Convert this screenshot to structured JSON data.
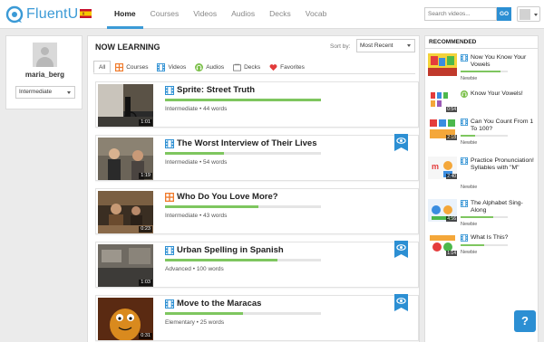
{
  "header": {
    "brand": "FluentU",
    "nav": [
      {
        "label": "Home",
        "active": true
      },
      {
        "label": "Courses",
        "active": false
      },
      {
        "label": "Videos",
        "active": false
      },
      {
        "label": "Audios",
        "active": false
      },
      {
        "label": "Decks",
        "active": false
      },
      {
        "label": "Vocab",
        "active": false
      }
    ],
    "search_placeholder": "Search videos...",
    "go_label": "GO"
  },
  "profile": {
    "username": "maria_berg",
    "level": "Intermediate"
  },
  "main": {
    "title": "NOW LEARNING",
    "sort_label": "Sort by:",
    "sort_value": "Most Recent",
    "filters": [
      {
        "label": "All",
        "icon": "none",
        "active": true
      },
      {
        "label": "Courses",
        "icon": "course-icon",
        "active": false
      },
      {
        "label": "Videos",
        "icon": "video-icon",
        "active": false
      },
      {
        "label": "Audios",
        "icon": "audio-icon",
        "active": false
      },
      {
        "label": "Decks",
        "icon": "deck-icon",
        "active": false
      },
      {
        "label": "Favorites",
        "icon": "heart-icon",
        "active": false
      }
    ],
    "cards": [
      {
        "title": "Sprite: Street Truth",
        "type": "video",
        "level": "Intermediate",
        "words": "44 words",
        "duration": "1:01",
        "progress": 1.0,
        "bookmarked": false
      },
      {
        "title": "The Worst Interview of Their Lives",
        "type": "video",
        "level": "Intermediate",
        "words": "54 words",
        "duration": "1:19",
        "progress": 0.38,
        "bookmarked": true
      },
      {
        "title": "Who Do You Love More?",
        "type": "course",
        "level": "Intermediate",
        "words": "43 words",
        "duration": "0:23",
        "progress": 0.6,
        "bookmarked": false
      },
      {
        "title": "Urban Spelling in Spanish",
        "type": "video",
        "level": "Advanced",
        "words": "100 words",
        "duration": "1:03",
        "progress": 0.72,
        "bookmarked": true
      },
      {
        "title": "Move to the Maracas",
        "type": "video",
        "level": "Elementary",
        "words": "25 words",
        "duration": "0:31",
        "progress": 0.5,
        "bookmarked": true
      }
    ]
  },
  "recommended": {
    "title": "RECOMMENDED",
    "items": [
      {
        "title": "Now You Know Your Vowels",
        "type": "video",
        "level": "Newbie",
        "duration": "",
        "progress": 0.85
      },
      {
        "title": "Know Your Vowels!",
        "type": "audio",
        "level": "",
        "duration": "0:54",
        "progress": 0
      },
      {
        "title": "Can You Count From 1 To 100?",
        "type": "video",
        "level": "Newbie",
        "duration": "2:18",
        "progress": 0.3
      },
      {
        "title": "Practice Pronunciation! Syllables with \"M\"",
        "type": "video",
        "level": "Newbie",
        "duration": "2:40",
        "progress": 0
      },
      {
        "title": "The Alphabet Sing-Along",
        "type": "video",
        "level": "Newbie",
        "duration": "4:56",
        "progress": 0.7
      },
      {
        "title": "What Is This?",
        "type": "video",
        "level": "Newbie",
        "duration": "1:14",
        "progress": 0.5
      }
    ]
  },
  "help_label": "?",
  "colors": {
    "accent": "#3b9ad6",
    "progress": "#7ec65f",
    "course": "#f07b2c",
    "audio": "#7cc04b",
    "heart": "#e23b3b"
  }
}
